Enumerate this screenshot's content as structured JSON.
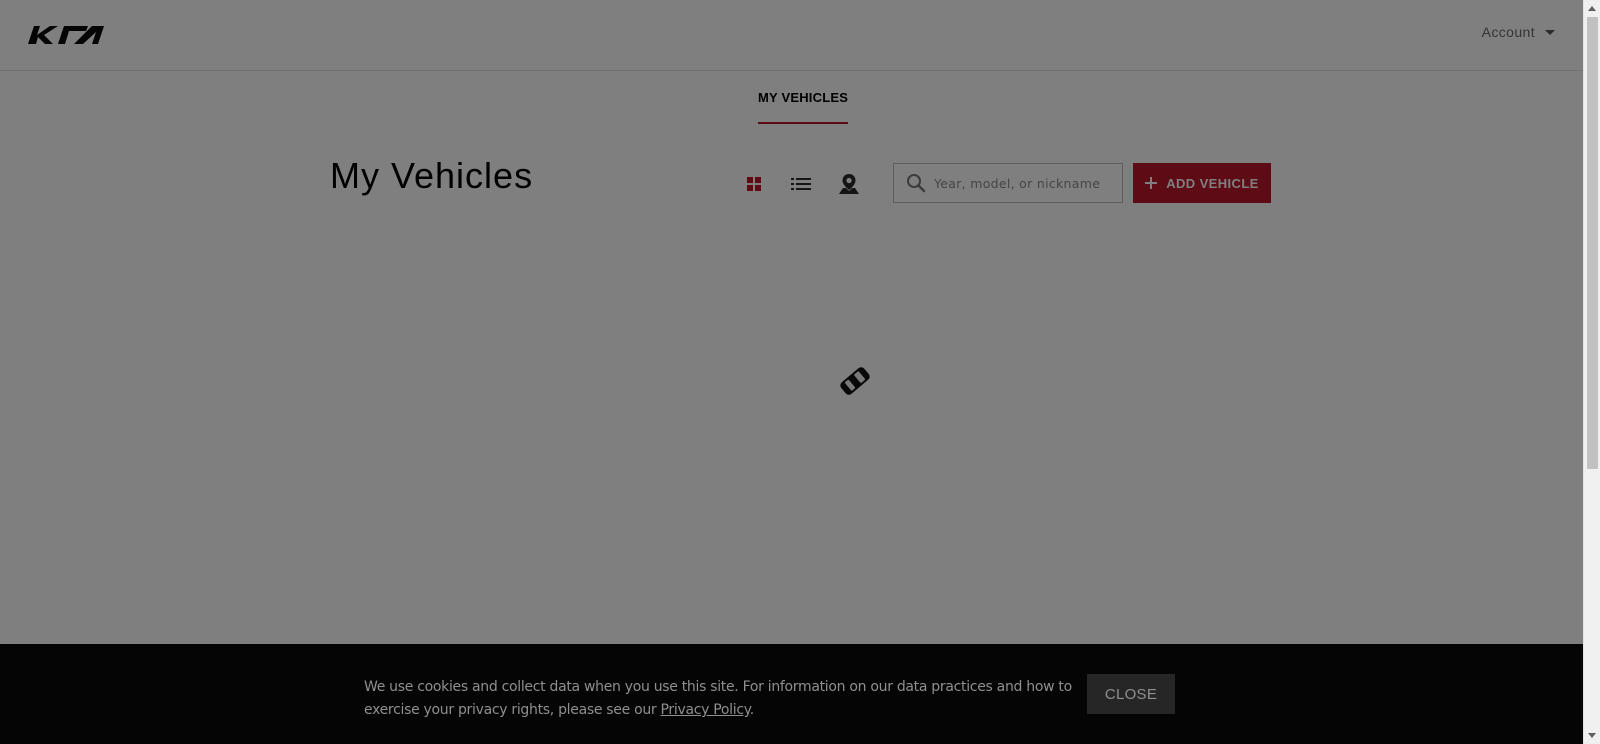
{
  "header": {
    "logo_alt": "KIA",
    "account_label": "Account"
  },
  "subnav": {
    "active_tab": "MY VEHICLES"
  },
  "main": {
    "title": "My Vehicles",
    "view_modes": [
      "grid-view-icon",
      "list-view-icon",
      "map-view-icon"
    ],
    "active_view": "grid",
    "search": {
      "placeholder": "Year, model, or nickname",
      "value": ""
    },
    "add_button_label": "ADD VEHICLE"
  },
  "cookie_banner": {
    "text": "We use cookies and collect data when you use this site. For information on our data practices and how to exercise your privacy rights, please see our ",
    "link_label": "Privacy Policy",
    "trailing": ".",
    "close_label": "CLOSE"
  },
  "colors": {
    "brand_red": "#bb162b",
    "overlay": "rgba(0,0,0,0.5)",
    "banner_bg": "#050505"
  }
}
